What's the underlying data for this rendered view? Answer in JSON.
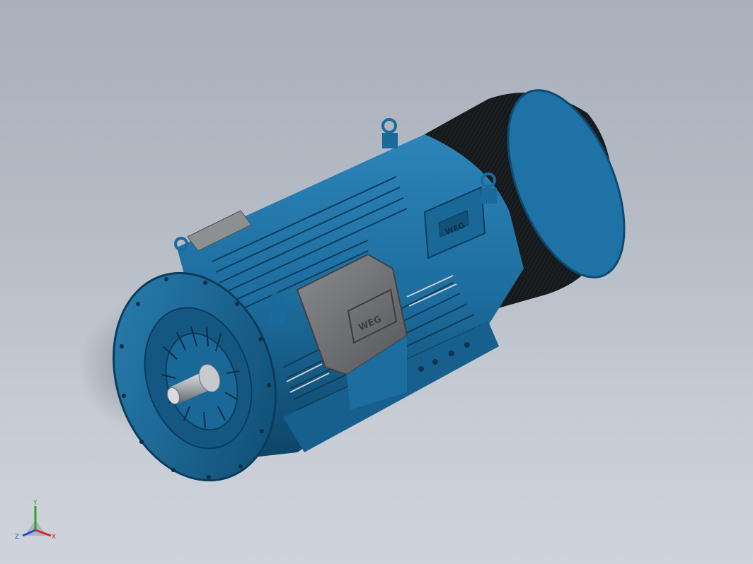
{
  "viewport": {
    "background_top": "#a9b0bb",
    "background_bottom": "#cfd3db"
  },
  "model": {
    "part_color": "#1d6d9e",
    "part_shadow": "#0f4a70",
    "fan_cover_color": "#111416",
    "terminal_box_color": "#6f7174",
    "logo_text": "WEG"
  },
  "triad": {
    "x_label": "X",
    "y_label": "Y",
    "z_label": "Z",
    "x_color": "#d42a2a",
    "y_color": "#2aa52a",
    "z_color": "#2a4ad4"
  }
}
